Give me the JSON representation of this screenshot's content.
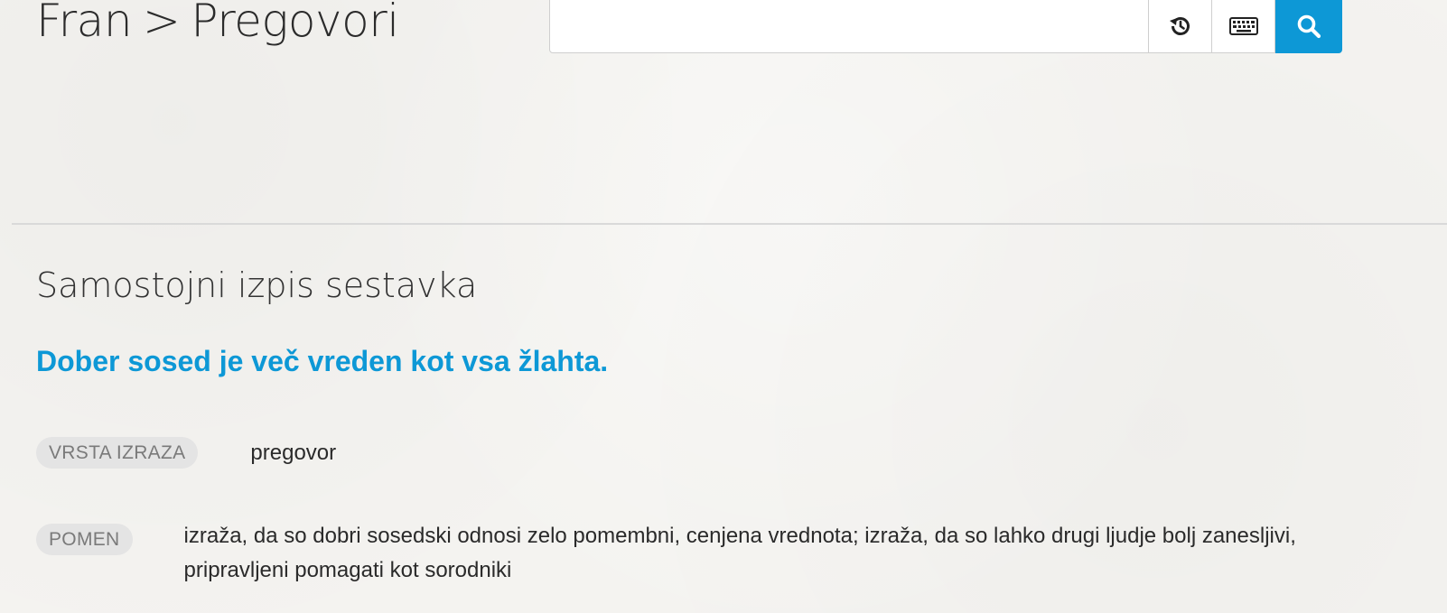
{
  "header": {
    "breadcrumb_root": "Fran",
    "breadcrumb_separator": ">",
    "breadcrumb_current": "Pregovori"
  },
  "search": {
    "value": "",
    "placeholder": "",
    "history_icon": "history-icon",
    "keyboard_icon": "keyboard-icon",
    "search_icon": "search-icon"
  },
  "colors": {
    "accent": "#0d98d6",
    "background": "#f4f3f0",
    "label_background": "#e4e4e4",
    "label_text": "#7a7a7a"
  },
  "main": {
    "section_title": "Samostojni izpis sestavka",
    "headword": "Dober sosed je več vreden kot vsa žlahta.",
    "fields": [
      {
        "label": "VRSTA IZRAZA",
        "value": "pregovor"
      },
      {
        "label": "POMEN",
        "value": "izraža, da so dobri sosedski odnosi zelo pomembni, cenjena vrednota; izraža, da so lahko drugi ljudje bolj zanesljivi, pripravljeni pomagati kot sorodniki"
      }
    ]
  }
}
